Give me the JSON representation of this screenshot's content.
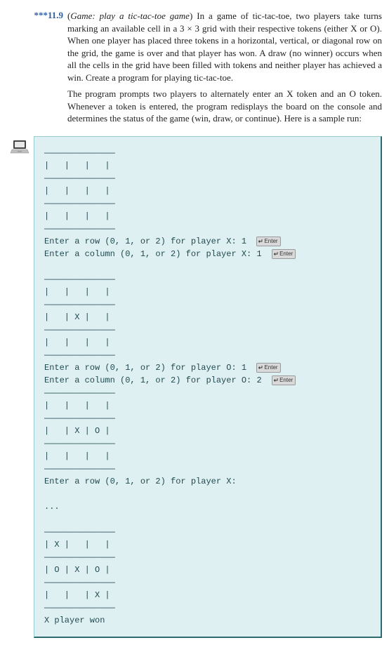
{
  "problem": {
    "prefix": "***",
    "number": "11.9",
    "title_prefix": "(",
    "title_italic": "Game: play a tic-tac-toe game",
    "title_suffix": ")",
    "para1_a": " In a game of tic-tac-toe, two players take turns marking an available cell in a 3 ",
    "times": "×",
    "para1_b": " 3 grid with their respective tokens (either X or O). When one player has placed three tokens in a horizontal, vertical, or diagonal row on the grid, the game is over and that player has won. A draw (no winner) occurs when all the cells in the grid have been filled with tokens and neither player has achieved a win. Create a program for playing tic-tac-toe.",
    "para2": "The program prompts two players to alternately enter an X token and an O token. Whenever a token is entered, the program redisplays the board on the console and determines the status of the game (win, draw, or continue). Here is a sample run:"
  },
  "run": {
    "sep": "——————————————",
    "rowEmpty": "|   |   |   |",
    "rowX1": "|   | X |   |",
    "rowXO1": "|   | X | O |",
    "rowFinal0": "| X |   |   |",
    "rowFinal1": "| O | X | O |",
    "rowFinal2": "|   |   | X |",
    "p_rowX_a": "Enter a row (0, 1, or 2) for player X: ",
    "p_colX_a": "Enter a column (0, 1, or 2) for player X: ",
    "valX_row": "1",
    "valX_col": "1",
    "p_rowO_a": "Enter a row (0, 1, or 2) for player O: ",
    "p_colO_a": "Enter a column (0, 1, or 2) for player O: ",
    "valO_row": "1",
    "valO_col": "2",
    "p_rowX_b": "Enter a row (0, 1, or 2) for player X:",
    "ellipsis": "...",
    "result": "X player won",
    "enter_label": "Enter"
  }
}
